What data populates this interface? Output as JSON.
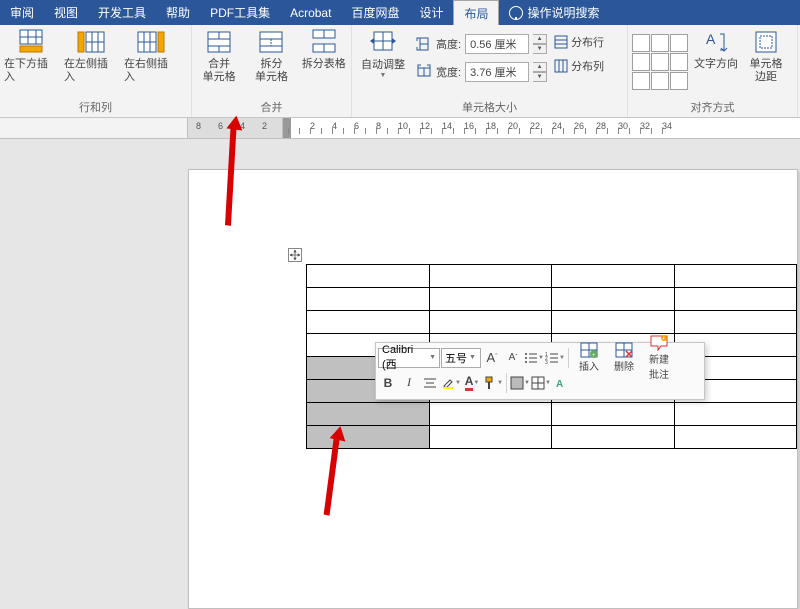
{
  "tabs": {
    "review": "审阅",
    "view": "视图",
    "dev": "开发工具",
    "help": "帮助",
    "pdf": "PDF工具集",
    "acrobat": "Acrobat",
    "baidu": "百度网盘",
    "design": "设计",
    "layout": "布局",
    "tell": "操作说明搜索"
  },
  "rows_cols": {
    "below": "在下方插入",
    "left": "在左侧插入",
    "right": "在右侧插入",
    "group": "行和列"
  },
  "merge": {
    "merge": "合并",
    "merge2": "单元格",
    "split": "拆分",
    "split2": "单元格",
    "split_tbl": "拆分表格",
    "group": "合并"
  },
  "autofit": "自动调整",
  "size": {
    "h_label": "高度:",
    "w_label": "宽度:",
    "h_val": "0.56 厘米",
    "w_val": "3.76 厘米",
    "dist_row": "分布行",
    "dist_col": "分布列",
    "group": "单元格大小"
  },
  "align": {
    "text_dir": "文字方向",
    "margin1": "单元格",
    "margin2": "边距",
    "group": "对齐方式"
  },
  "ruler": [
    "8",
    "6",
    "4",
    "2",
    "2",
    "4",
    "6",
    "8",
    "10",
    "12",
    "14",
    "16",
    "18",
    "20",
    "22",
    "24",
    "26",
    "28",
    "30",
    "32",
    "34"
  ],
  "mini": {
    "font": "Calibri (西",
    "size": "五号",
    "ins": "插入",
    "del": "删除",
    "new1": "新建",
    "new2": "批注"
  },
  "chart_data": null
}
